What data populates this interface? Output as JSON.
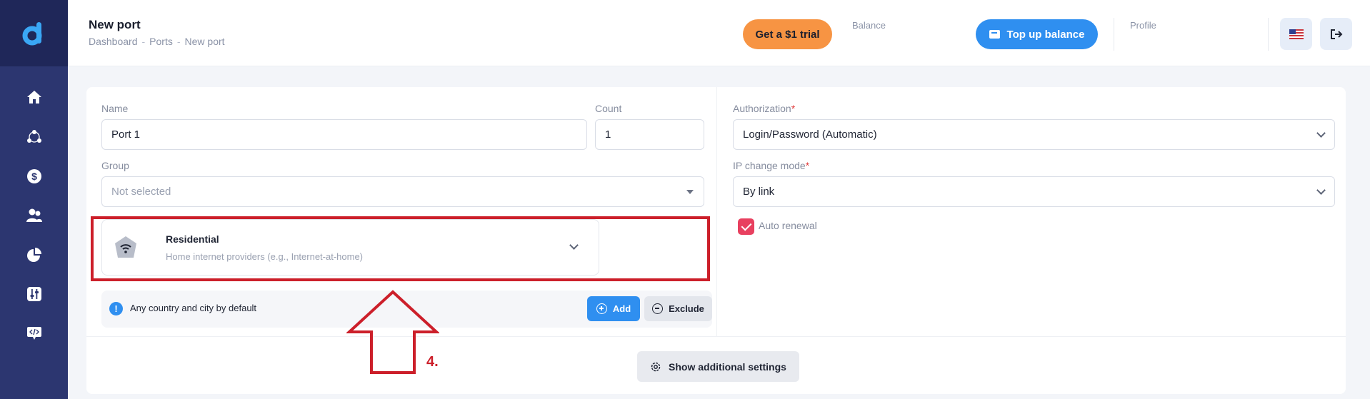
{
  "header": {
    "title": "New port",
    "breadcrumb": [
      "Dashboard",
      "Ports",
      "New port"
    ],
    "breadcrumb_sep": "-",
    "trial_label": "Get a $1 trial",
    "balance_label": "Balance",
    "topup_label": "Top up balance",
    "profile_label": "Profile"
  },
  "sidebar": {
    "items": [
      "home-icon",
      "network-icon",
      "dollar-icon",
      "users-icon",
      "pie-chart-icon",
      "sliders-icon",
      "code-icon"
    ]
  },
  "form": {
    "name_label": "Name",
    "name_value": "Port 1",
    "count_label": "Count",
    "count_value": "1",
    "group_label": "Group",
    "group_placeholder": "Not selected",
    "auth_label": "Authorization",
    "auth_value": "Login/Password (Automatic)",
    "ip_mode_label": "IP change mode",
    "ip_mode_value": "By link",
    "required_mark": "*",
    "auto_renewal_label": "Auto renewal",
    "auto_renewal_checked": true
  },
  "proxy_type": {
    "title": "Residential",
    "subtitle": "Home internet providers (e.g., Internet-at-home)"
  },
  "location": {
    "info_text": "Any country and city by default",
    "info_mark": "!",
    "add_label": "Add",
    "exclude_label": "Exclude"
  },
  "footer": {
    "more_settings_label": "Show additional settings"
  },
  "annotation": {
    "step": "4."
  },
  "colors": {
    "sidebar": "#2c3670",
    "accent_blue": "#2f8ff0",
    "trial_orange": "#f79443",
    "checkbox_red": "#e8405f",
    "annotation_red": "#cc1f2a"
  }
}
